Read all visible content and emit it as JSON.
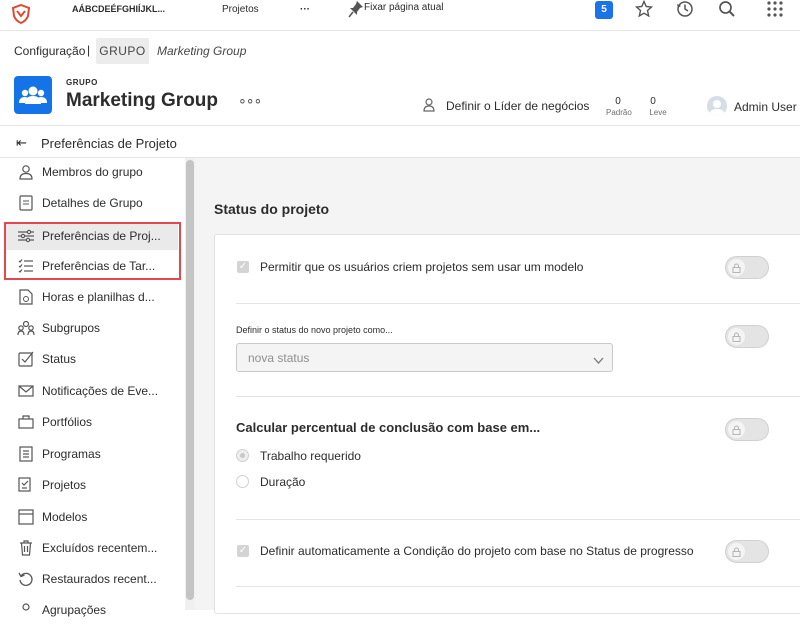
{
  "topbar": {
    "truncated_tab": "AÁBCDEÉFGHIÍJKL...",
    "projetos": "Projetos",
    "more": "···",
    "pin": "Fixar página atual",
    "notifications_count": "5"
  },
  "breadcrumb": {
    "root": "Configuração",
    "sep": "|",
    "group_tag": "GRUPO",
    "current": "Marketing Group"
  },
  "header": {
    "label": "GRUPO",
    "title": "Marketing Group",
    "more": "∘∘∘",
    "owner": "Definir o Líder de negócios",
    "counts": [
      {
        "value": "0",
        "label": "Padrão"
      },
      {
        "value": "0",
        "label": "Leve"
      }
    ],
    "user": "Admin User"
  },
  "page": {
    "back": "⇤",
    "title": "Preferências de Projeto"
  },
  "sidebar": {
    "items": [
      {
        "label": "Membros do grupo",
        "icon": "users-icon"
      },
      {
        "label": "Detalhes de Grupo",
        "icon": "document-icon"
      },
      {
        "label": "Preferências de Proj...",
        "icon": "sliders-icon"
      },
      {
        "label": "Preferências de Tar...",
        "icon": "task-list-icon"
      },
      {
        "label": "Horas e planilhas d...",
        "icon": "timesheet-icon"
      },
      {
        "label": "Subgrupos",
        "icon": "subgroups-icon"
      },
      {
        "label": "Status",
        "icon": "status-icon"
      },
      {
        "label": "Notificações de Eve...",
        "icon": "mail-icon"
      },
      {
        "label": "Portfólios",
        "icon": "portfolio-icon"
      },
      {
        "label": "Programas",
        "icon": "program-icon"
      },
      {
        "label": "Projetos",
        "icon": "project-icon"
      },
      {
        "label": "Modelos",
        "icon": "template-icon"
      },
      {
        "label": "Excluídos recentem...",
        "icon": "trash-icon"
      },
      {
        "label": "Restaurados recent...",
        "icon": "restore-icon"
      },
      {
        "label": "Agrupações",
        "icon": "grouping-icon"
      }
    ]
  },
  "main": {
    "section_title": "Status do projeto",
    "row1": "Permitir que os usuários criem projetos sem usar um modelo",
    "status_label": "Definir o status do novo projeto como...",
    "status_value": "nova status",
    "calc_title": "Calcular percentual de conclusão com base em...",
    "radio1": "Trabalho requerido",
    "radio2": "Duração",
    "row4": "Definir automaticamente a Condição do projeto com base no Status de progresso"
  },
  "colors": {
    "accent": "#1473e6",
    "highlight": "#e34850"
  }
}
